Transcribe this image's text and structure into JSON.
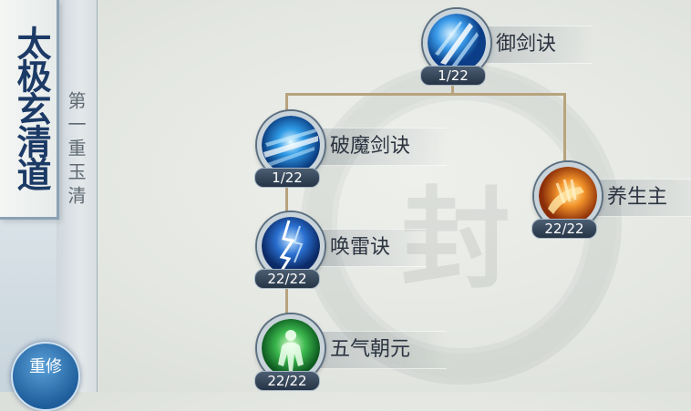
{
  "sidebar": {
    "title": "太极玄清道",
    "stage": "第一重玉清",
    "reset_label": "重修"
  },
  "skills": [
    {
      "name": "御剑诀",
      "level": "1/22",
      "icon": "sword-qi-icon",
      "color": "#2f8fe0"
    },
    {
      "name": "破魔剑诀",
      "level": "1/22",
      "icon": "demon-breaking-sword-icon",
      "color": "#2f8fe0"
    },
    {
      "name": "养生主",
      "level": "22/22",
      "icon": "healing-palm-icon",
      "color": "#e0862a"
    },
    {
      "name": "唤雷诀",
      "level": "22/22",
      "icon": "thunder-icon",
      "color": "#2f6fd0"
    },
    {
      "name": "五气朝元",
      "level": "22/22",
      "icon": "meditation-figure-icon",
      "color": "#2fae4a"
    }
  ],
  "watermark": "封"
}
